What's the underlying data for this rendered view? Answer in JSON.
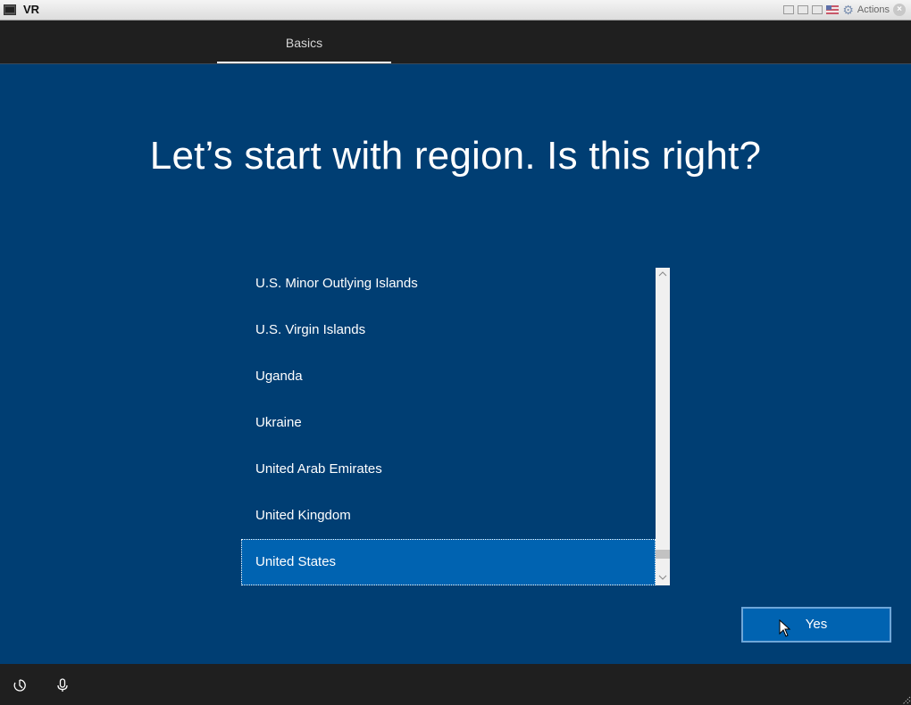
{
  "window": {
    "title": "VR",
    "actions_label": "Actions"
  },
  "header": {
    "tabs": [
      {
        "label": "Basics",
        "active": true
      }
    ]
  },
  "main": {
    "title": "Let’s start with region. Is this right?",
    "region_list": {
      "items": [
        {
          "label": "U.S. Minor Outlying Islands",
          "selected": false
        },
        {
          "label": "U.S. Virgin Islands",
          "selected": false
        },
        {
          "label": "Uganda",
          "selected": false
        },
        {
          "label": "Ukraine",
          "selected": false
        },
        {
          "label": "United Arab Emirates",
          "selected": false
        },
        {
          "label": "United Kingdom",
          "selected": false
        },
        {
          "label": "United States",
          "selected": true
        }
      ],
      "selected_value": "United States"
    },
    "yes_button_label": "Yes"
  },
  "footer": {
    "icons": [
      "ease-of-access-icon",
      "microphone-icon"
    ]
  },
  "colors": {
    "background": "#003e73",
    "header_bg": "#1f1f1f",
    "accent": "#0063b1",
    "text": "#ffffff"
  }
}
